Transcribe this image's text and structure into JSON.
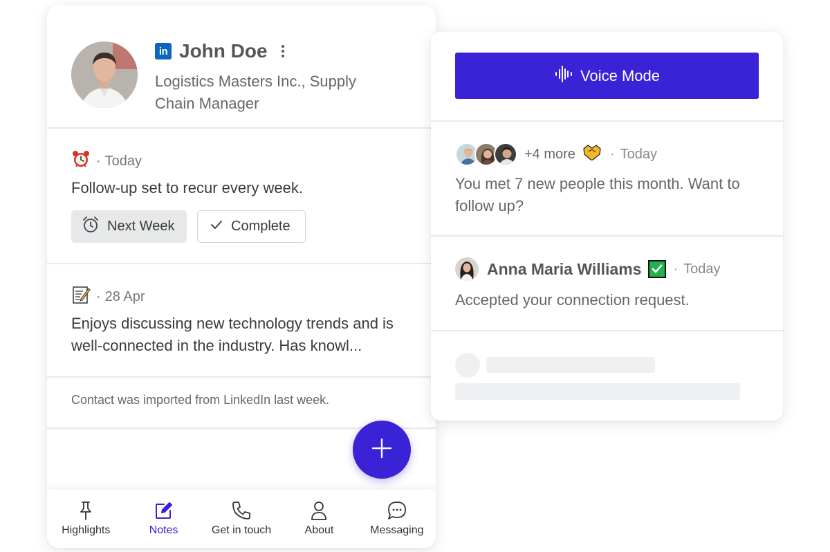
{
  "profile": {
    "name": "John Doe",
    "title": "Logistics Masters Inc., Supply Chain Manager",
    "linkedin_badge": "in"
  },
  "reminder": {
    "icon": "alarm-clock-icon",
    "date": "Today",
    "text": "Follow-up set to recur every week.",
    "next_week_label": "Next Week",
    "complete_label": "Complete"
  },
  "note": {
    "icon": "memo-icon",
    "date": "28 Apr",
    "text": "Enjoys discussing new technology trends and is well-connected in the industry. Has knowl..."
  },
  "import_info": {
    "text": "Contact was imported from LinkedIn last week."
  },
  "bottom_nav": {
    "items": [
      {
        "label": "Highlights",
        "icon": "pin-icon"
      },
      {
        "label": "Notes",
        "icon": "edit-icon",
        "active": true
      },
      {
        "label": "Get in touch",
        "icon": "phone-icon"
      },
      {
        "label": "About",
        "icon": "person-icon"
      },
      {
        "label": "Messaging",
        "icon": "chat-icon"
      }
    ]
  },
  "voice": {
    "label": "Voice Mode"
  },
  "new_people": {
    "more": "+4 more",
    "date": "Today",
    "text": "You met 7 new people this month. Want to follow up?"
  },
  "connection": {
    "name": "Anna Maria Williams",
    "date": "Today",
    "text": "Accepted your connection request."
  },
  "separator": "·",
  "colors": {
    "accent": "#3a22d6",
    "linkedin": "#0a66c2",
    "check_green": "#22b14c"
  }
}
